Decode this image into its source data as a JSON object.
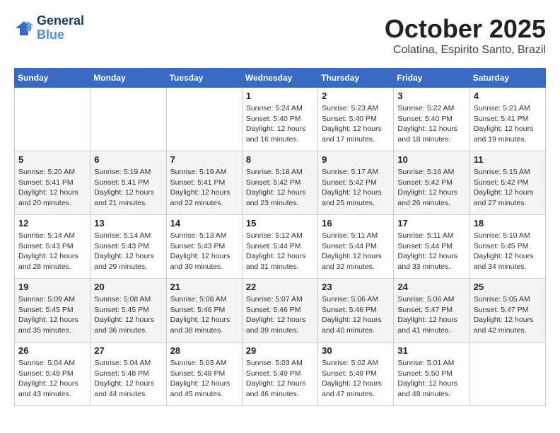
{
  "logo": {
    "line1": "General",
    "line2": "Blue"
  },
  "title": "October 2025",
  "subtitle": "Colatina, Espirito Santo, Brazil",
  "weekdays": [
    "Sunday",
    "Monday",
    "Tuesday",
    "Wednesday",
    "Thursday",
    "Friday",
    "Saturday"
  ],
  "weeks": [
    [
      {
        "day": "",
        "info": ""
      },
      {
        "day": "",
        "info": ""
      },
      {
        "day": "",
        "info": ""
      },
      {
        "day": "1",
        "info": "Sunrise: 5:24 AM\nSunset: 5:40 PM\nDaylight: 12 hours\nand 16 minutes."
      },
      {
        "day": "2",
        "info": "Sunrise: 5:23 AM\nSunset: 5:40 PM\nDaylight: 12 hours\nand 17 minutes."
      },
      {
        "day": "3",
        "info": "Sunrise: 5:22 AM\nSunset: 5:40 PM\nDaylight: 12 hours\nand 18 minutes."
      },
      {
        "day": "4",
        "info": "Sunrise: 5:21 AM\nSunset: 5:41 PM\nDaylight: 12 hours\nand 19 minutes."
      }
    ],
    [
      {
        "day": "5",
        "info": "Sunrise: 5:20 AM\nSunset: 5:41 PM\nDaylight: 12 hours\nand 20 minutes."
      },
      {
        "day": "6",
        "info": "Sunrise: 5:19 AM\nSunset: 5:41 PM\nDaylight: 12 hours\nand 21 minutes."
      },
      {
        "day": "7",
        "info": "Sunrise: 5:19 AM\nSunset: 5:41 PM\nDaylight: 12 hours\nand 22 minutes."
      },
      {
        "day": "8",
        "info": "Sunrise: 5:18 AM\nSunset: 5:42 PM\nDaylight: 12 hours\nand 23 minutes."
      },
      {
        "day": "9",
        "info": "Sunrise: 5:17 AM\nSunset: 5:42 PM\nDaylight: 12 hours\nand 25 minutes."
      },
      {
        "day": "10",
        "info": "Sunrise: 5:16 AM\nSunset: 5:42 PM\nDaylight: 12 hours\nand 26 minutes."
      },
      {
        "day": "11",
        "info": "Sunrise: 5:15 AM\nSunset: 5:42 PM\nDaylight: 12 hours\nand 27 minutes."
      }
    ],
    [
      {
        "day": "12",
        "info": "Sunrise: 5:14 AM\nSunset: 5:43 PM\nDaylight: 12 hours\nand 28 minutes."
      },
      {
        "day": "13",
        "info": "Sunrise: 5:14 AM\nSunset: 5:43 PM\nDaylight: 12 hours\nand 29 minutes."
      },
      {
        "day": "14",
        "info": "Sunrise: 5:13 AM\nSunset: 5:43 PM\nDaylight: 12 hours\nand 30 minutes."
      },
      {
        "day": "15",
        "info": "Sunrise: 5:12 AM\nSunset: 5:44 PM\nDaylight: 12 hours\nand 31 minutes."
      },
      {
        "day": "16",
        "info": "Sunrise: 5:11 AM\nSunset: 5:44 PM\nDaylight: 12 hours\nand 32 minutes."
      },
      {
        "day": "17",
        "info": "Sunrise: 5:11 AM\nSunset: 5:44 PM\nDaylight: 12 hours\nand 33 minutes."
      },
      {
        "day": "18",
        "info": "Sunrise: 5:10 AM\nSunset: 5:45 PM\nDaylight: 12 hours\nand 34 minutes."
      }
    ],
    [
      {
        "day": "19",
        "info": "Sunrise: 5:09 AM\nSunset: 5:45 PM\nDaylight: 12 hours\nand 35 minutes."
      },
      {
        "day": "20",
        "info": "Sunrise: 5:08 AM\nSunset: 5:45 PM\nDaylight: 12 hours\nand 36 minutes."
      },
      {
        "day": "21",
        "info": "Sunrise: 5:08 AM\nSunset: 5:46 PM\nDaylight: 12 hours\nand 38 minutes."
      },
      {
        "day": "22",
        "info": "Sunrise: 5:07 AM\nSunset: 5:46 PM\nDaylight: 12 hours\nand 39 minutes."
      },
      {
        "day": "23",
        "info": "Sunrise: 5:06 AM\nSunset: 5:46 PM\nDaylight: 12 hours\nand 40 minutes."
      },
      {
        "day": "24",
        "info": "Sunrise: 5:06 AM\nSunset: 5:47 PM\nDaylight: 12 hours\nand 41 minutes."
      },
      {
        "day": "25",
        "info": "Sunrise: 5:05 AM\nSunset: 5:47 PM\nDaylight: 12 hours\nand 42 minutes."
      }
    ],
    [
      {
        "day": "26",
        "info": "Sunrise: 5:04 AM\nSunset: 5:48 PM\nDaylight: 12 hours\nand 43 minutes."
      },
      {
        "day": "27",
        "info": "Sunrise: 5:04 AM\nSunset: 5:48 PM\nDaylight: 12 hours\nand 44 minutes."
      },
      {
        "day": "28",
        "info": "Sunrise: 5:03 AM\nSunset: 5:48 PM\nDaylight: 12 hours\nand 45 minutes."
      },
      {
        "day": "29",
        "info": "Sunrise: 5:03 AM\nSunset: 5:49 PM\nDaylight: 12 hours\nand 46 minutes."
      },
      {
        "day": "30",
        "info": "Sunrise: 5:02 AM\nSunset: 5:49 PM\nDaylight: 12 hours\nand 47 minutes."
      },
      {
        "day": "31",
        "info": "Sunrise: 5:01 AM\nSunset: 5:50 PM\nDaylight: 12 hours\nand 48 minutes."
      },
      {
        "day": "",
        "info": ""
      }
    ]
  ]
}
